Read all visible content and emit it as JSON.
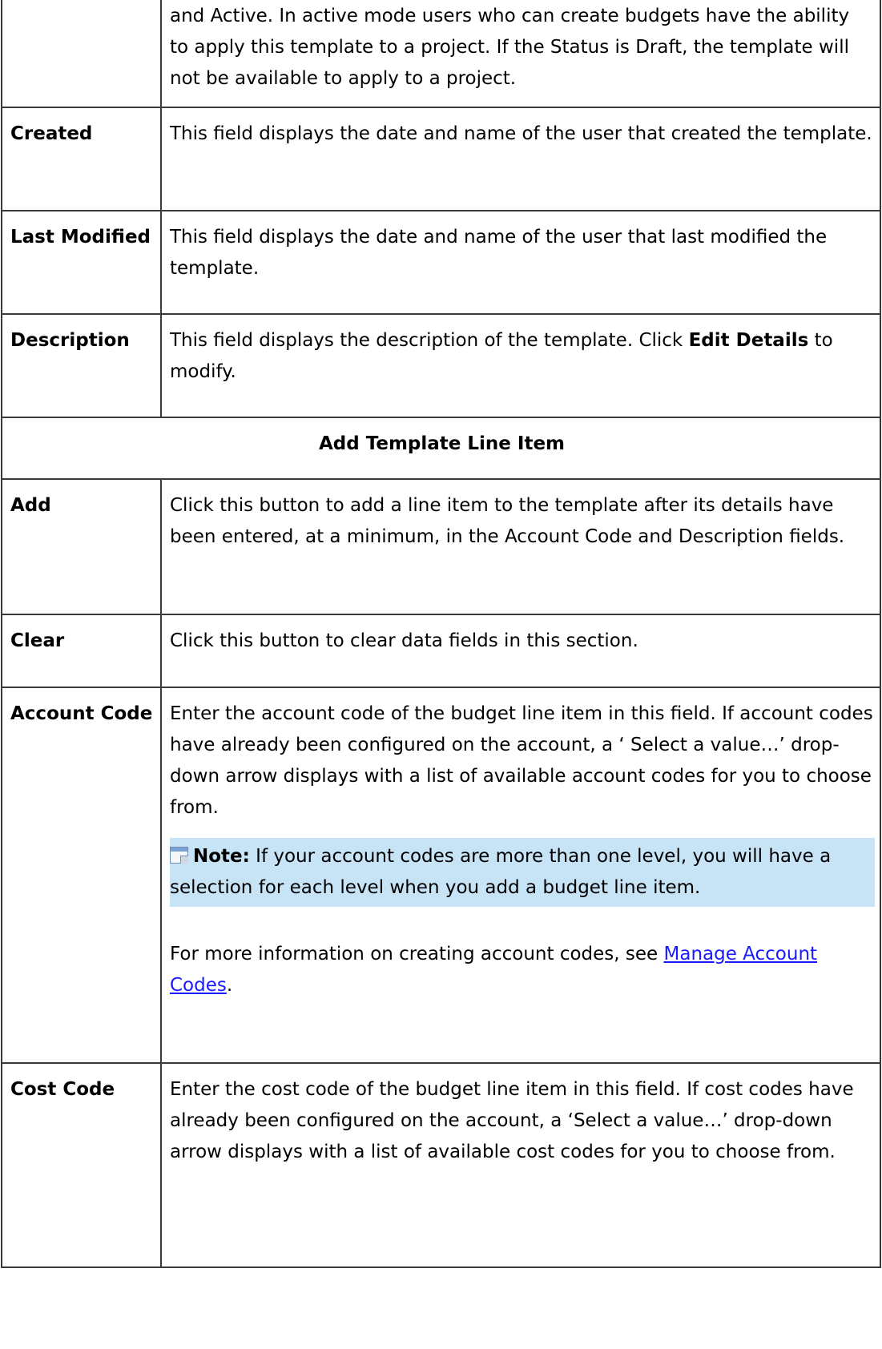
{
  "rows": {
    "status_cont": {
      "desc": "and Active. In active mode users who can create budgets have the ability to apply this template to a project.  If the Status is Draft, the template will not be available to apply to a project."
    },
    "created": {
      "term": "Created",
      "desc": "This field displays the date and name of the user that created the template."
    },
    "last_modified": {
      "term": "Last Modified",
      "desc": "This field displays the date and name of the user that last modified the template."
    },
    "description": {
      "term": "Description",
      "desc_pre": "This field displays the description of the template. Click ",
      "desc_bold": "Edit Details",
      "desc_post": " to modify."
    },
    "section_title": "Add Template Line Item",
    "add": {
      "term": "Add",
      "desc": "Click this button to add a line item to the template after its details have been entered, at a minimum, in the Account Code and Description fields."
    },
    "clear": {
      "term": "Clear",
      "desc": "Click this button to clear data fields in this section."
    },
    "account_code": {
      "term": "Account Code",
      "desc": "Enter the account code of the budget line item in this field. If account codes have already been configured on the account, a ‘ Select a value…’ drop-down arrow displays with a list of available account codes for you to choose from.",
      "note_label": "Note:",
      "note_text": " If your account codes are more than one level, you will have a selection for each level when you add a budget line item.",
      "more_pre": "For more information on creating account codes, see ",
      "more_link": "Manage Account Codes",
      "more_post": "."
    },
    "cost_code": {
      "term": "Cost Code",
      "desc": "Enter the cost code of the budget line item in this field. If cost codes have already been configured on the account, a ‘Select a value…’ drop-down arrow displays with a list of available cost codes for you to choose from."
    }
  },
  "icons": {
    "note": "note-icon"
  },
  "colors": {
    "note_bg": "#c7e3f6",
    "link": "#1a1aff",
    "border": "#3a3a3a"
  }
}
